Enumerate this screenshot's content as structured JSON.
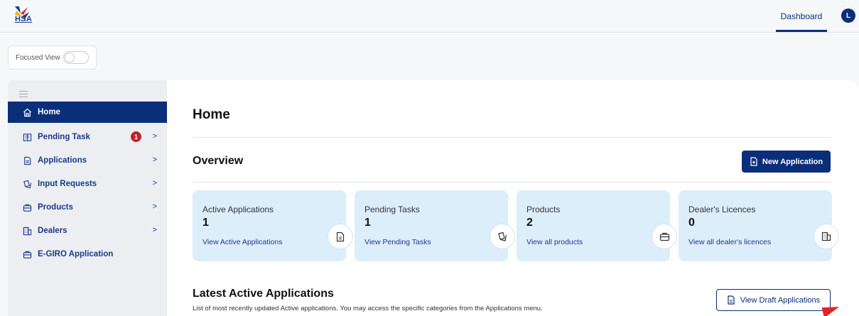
{
  "header": {
    "logo_text": "HSA",
    "nav_dashboard": "Dashboard",
    "avatar_initial": "L",
    "brand_color": "#0b2e7a"
  },
  "focused_view": {
    "label": "Focused View",
    "enabled": false
  },
  "sidebar": {
    "items": [
      {
        "label": "Home",
        "icon": "home-icon",
        "active": true
      },
      {
        "label": "Pending Task",
        "icon": "tasks-icon",
        "badge": "1"
      },
      {
        "label": "Applications",
        "icon": "document-icon"
      },
      {
        "label": "Input Requests",
        "icon": "request-icon"
      },
      {
        "label": "Products",
        "icon": "product-icon"
      },
      {
        "label": "Dealers",
        "icon": "building-icon"
      },
      {
        "label": "E-GIRO Application",
        "icon": "product-icon"
      }
    ],
    "chevron": ">"
  },
  "main": {
    "page_title": "Home",
    "overview_title": "Overview",
    "new_application_label": "New Application",
    "cards": [
      {
        "label": "Active Applications",
        "value": "1",
        "link": "View Active Applications",
        "icon": "document-icon"
      },
      {
        "label": "Pending Tasks",
        "value": "1",
        "link": "View Pending Tasks",
        "icon": "request-icon"
      },
      {
        "label": "Products",
        "value": "2",
        "link": "View all products",
        "icon": "product-icon"
      },
      {
        "label": "Dealer's Licences",
        "value": "0",
        "link": "View all dealer's licences",
        "icon": "building-icon"
      }
    ],
    "latest_title": "Latest Active Applications",
    "latest_subtitle": "List of most recently updated Active applications. You may access the specific categories from the Applications menu.",
    "view_drafts_label": "View Draft Applications"
  }
}
